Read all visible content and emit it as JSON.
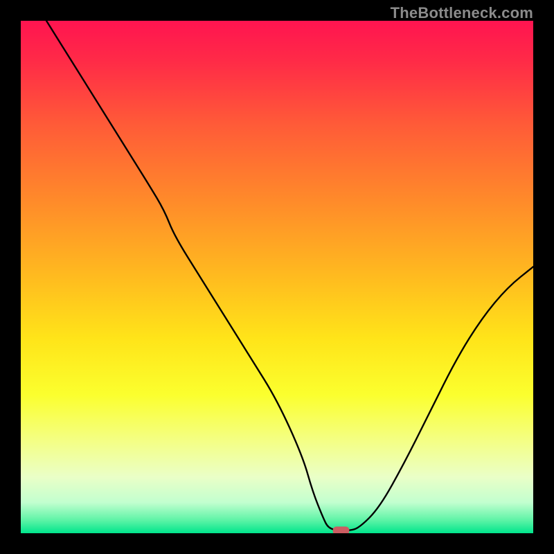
{
  "watermark": "TheBottleneck.com",
  "chart_data": {
    "type": "line",
    "title": "",
    "xlabel": "",
    "ylabel": "",
    "xlim": [
      0,
      100
    ],
    "ylim": [
      0,
      100
    ],
    "grid": false,
    "legend": false,
    "background_gradient": [
      {
        "pos": 0.0,
        "color": "#ff1450"
      },
      {
        "pos": 0.08,
        "color": "#ff2b47"
      },
      {
        "pos": 0.2,
        "color": "#ff5a38"
      },
      {
        "pos": 0.35,
        "color": "#ff8a2a"
      },
      {
        "pos": 0.5,
        "color": "#ffbb1f"
      },
      {
        "pos": 0.62,
        "color": "#ffe419"
      },
      {
        "pos": 0.73,
        "color": "#fbff2e"
      },
      {
        "pos": 0.82,
        "color": "#f4ff85"
      },
      {
        "pos": 0.89,
        "color": "#eaffc7"
      },
      {
        "pos": 0.94,
        "color": "#c2ffcf"
      },
      {
        "pos": 0.975,
        "color": "#5cf3a6"
      },
      {
        "pos": 1.0,
        "color": "#00e58c"
      }
    ],
    "series": [
      {
        "name": "bottleneck-curve",
        "color": "#000000",
        "x": [
          5,
          10,
          15,
          20,
          25,
          28,
          30,
          35,
          40,
          45,
          50,
          55,
          57,
          59,
          60,
          62,
          64,
          66,
          70,
          75,
          80,
          85,
          90,
          95,
          100
        ],
        "y": [
          100,
          92,
          84,
          76,
          68,
          63,
          58,
          50,
          42,
          34,
          26,
          15,
          8,
          3,
          1,
          0.5,
          0.5,
          1,
          5,
          14,
          24,
          34,
          42,
          48,
          52
        ]
      }
    ],
    "marker": {
      "name": "optimal-point",
      "x": 62.5,
      "y": 0.5,
      "color": "#cc5d62",
      "shape": "rounded-rect",
      "width_pct": 3.2,
      "height_pct": 1.6
    }
  }
}
